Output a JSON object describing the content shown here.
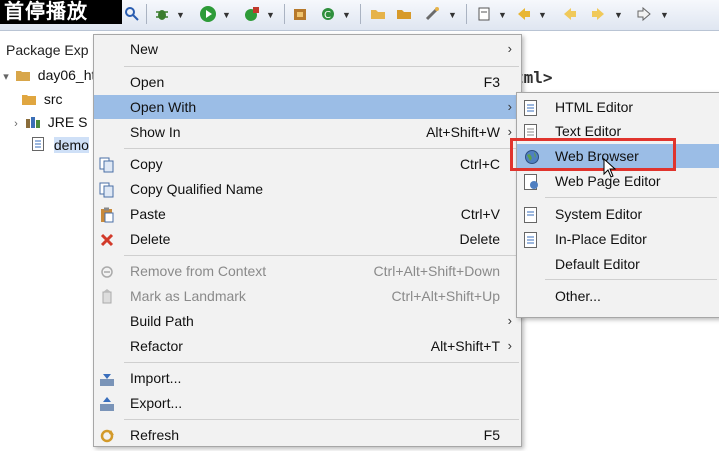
{
  "overlay": {
    "title": "首停播放"
  },
  "toolbar": {
    "icons": [
      "search-icon",
      "debug-icon",
      "run-icon",
      "run-external-icon",
      "package-icon",
      "refresh-green-icon",
      "folder-open-icon",
      "folder-icon",
      "tools-icon",
      "navigate-icon",
      "back-icon",
      "forward-icon"
    ]
  },
  "package_explorer": {
    "tab_label": "Package Exp",
    "tree": [
      {
        "label": "day06_ht",
        "expanded": true
      },
      {
        "label": "src"
      },
      {
        "label": "JRE S"
      },
      {
        "label": "demo",
        "selected": true
      }
    ]
  },
  "editor": {
    "visible_text": "tml>"
  },
  "context_menu": {
    "items": [
      {
        "label": "New",
        "shortcut": "",
        "submenu": true
      },
      {
        "label": "Open",
        "shortcut": "F3"
      },
      {
        "label": "Open With",
        "shortcut": "",
        "submenu": true,
        "highlighted": true
      },
      {
        "label": "Show In",
        "shortcut": "Alt+Shift+W",
        "submenu": true
      },
      {
        "label": "Copy",
        "shortcut": "Ctrl+C",
        "icon": "copy-icon"
      },
      {
        "label": "Copy Qualified Name",
        "shortcut": "",
        "icon": "copy-qualified-icon"
      },
      {
        "label": "Paste",
        "shortcut": "Ctrl+V",
        "icon": "paste-icon"
      },
      {
        "label": "Delete",
        "shortcut": "Delete",
        "icon": "delete-icon"
      },
      {
        "label": "Remove from Context",
        "shortcut": "Ctrl+Alt+Shift+Down",
        "disabled": true,
        "icon": "remove-context-icon"
      },
      {
        "label": "Mark as Landmark",
        "shortcut": "Ctrl+Alt+Shift+Up",
        "disabled": true,
        "icon": "landmark-icon"
      },
      {
        "label": "Build Path",
        "shortcut": "",
        "submenu": true
      },
      {
        "label": "Refactor",
        "shortcut": "Alt+Shift+T",
        "submenu": true
      },
      {
        "label": "Import...",
        "shortcut": "",
        "icon": "import-icon"
      },
      {
        "label": "Export...",
        "shortcut": "",
        "icon": "export-icon"
      },
      {
        "label": "Refresh",
        "shortcut": "F5",
        "icon": "refresh-icon"
      }
    ]
  },
  "open_with_submenu": {
    "items": [
      {
        "label": "HTML Editor",
        "icon": "html-editor-icon"
      },
      {
        "label": "Text Editor",
        "icon": "text-editor-icon"
      },
      {
        "label": "Web Browser",
        "icon": "globe-icon",
        "highlighted": true
      },
      {
        "label": "Web Page Editor",
        "icon": "web-page-editor-icon"
      },
      {
        "label": "System Editor",
        "icon": "system-editor-icon"
      },
      {
        "label": "In-Place Editor",
        "icon": "in-place-editor-icon"
      },
      {
        "label": "Default Editor",
        "icon": ""
      },
      {
        "label": "Other...",
        "icon": ""
      }
    ]
  },
  "colors": {
    "highlight": "#9bbde6",
    "annotation_box": "#e0342d",
    "menu_bg": "#f2f2f2"
  }
}
